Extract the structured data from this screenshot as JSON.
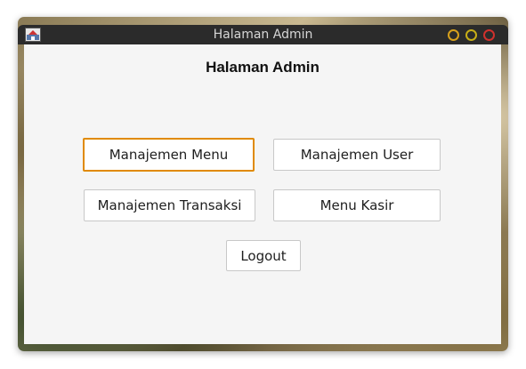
{
  "window": {
    "title": "Halaman Admin",
    "controls": {
      "minimize_color": "#d7a01c",
      "maximize_color": "#c7ae16",
      "close_color": "#d0312d"
    }
  },
  "main": {
    "heading": "Halaman Admin",
    "buttons": {
      "menu": "Manajemen Menu",
      "user": "Manajemen User",
      "transaksi": "Manajemen Transaksi",
      "kasir": "Menu Kasir",
      "logout": "Logout"
    },
    "focus_color": "#e08a00"
  }
}
